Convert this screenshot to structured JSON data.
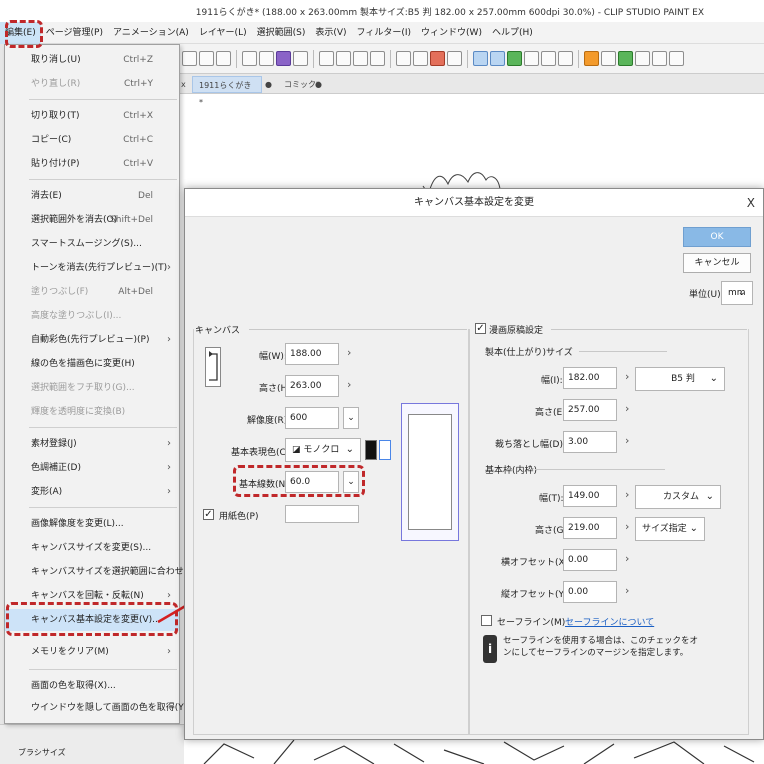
{
  "window": {
    "title": "1911らくがき* (188.00 x 263.00mm 製本サイズ:B5 判 182.00 x 257.00mm 600dpi 30.0%) - CLIP STUDIO PAINT EX"
  },
  "menubar": {
    "items": [
      "編集(E)",
      "ページ管理(P)",
      "アニメーション(A)",
      "レイヤー(L)",
      "選択範囲(S)",
      "表示(V)",
      "フィルター(I)",
      "ウィンドウ(W)",
      "ヘルプ(H)"
    ]
  },
  "doc_tabs": [
    {
      "label": "1911らくがき*",
      "close": "x",
      "dot": "●"
    },
    {
      "label": "コミック*",
      "dot": "●"
    }
  ],
  "edit_menu": {
    "items": [
      {
        "label": "取り消し(U)",
        "shortcut": "Ctrl+Z"
      },
      {
        "label": "やり直し(R)",
        "shortcut": "Ctrl+Y",
        "disabled": true
      },
      {
        "label": "切り取り(T)",
        "shortcut": "Ctrl+X"
      },
      {
        "label": "コピー(C)",
        "shortcut": "Ctrl+C"
      },
      {
        "label": "貼り付け(P)",
        "shortcut": "Ctrl+V"
      },
      {
        "label": "消去(E)",
        "shortcut": "Del"
      },
      {
        "label": "選択範囲外を消去(O)",
        "shortcut": "Shift+Del"
      },
      {
        "label": "スマートスムージング(S)..."
      },
      {
        "label": "トーンを消去(先行プレビュー)(T)",
        "submenu": true
      },
      {
        "label": "塗りつぶし(F)",
        "shortcut": "Alt+Del",
        "disabled": true
      },
      {
        "label": "高度な塗りつぶし(I)...",
        "disabled": true
      },
      {
        "label": "自動彩色(先行プレビュー)(P)",
        "submenu": true
      },
      {
        "label": "線の色を描画色に変更(H)"
      },
      {
        "label": "選択範囲をフチ取り(G)...",
        "disabled": true
      },
      {
        "label": "輝度を透明度に変換(B)",
        "disabled": true
      },
      {
        "label": "素材登録(J)",
        "submenu": true
      },
      {
        "label": "色調補正(D)",
        "submenu": true
      },
      {
        "label": "変形(A)",
        "submenu": true
      },
      {
        "label": "画像解像度を変更(L)..."
      },
      {
        "label": "キャンバスサイズを変更(S)..."
      },
      {
        "label": "キャンバスサイズを選択範囲に合わせる(Z)"
      },
      {
        "label": "キャンバスを回転・反転(N)",
        "submenu": true
      },
      {
        "label": "キャンバス基本設定を変更(V)..."
      },
      {
        "label": "メモリをクリア(M)",
        "submenu": true
      },
      {
        "label": "画面の色を取得(X)..."
      },
      {
        "label": "ウインドウを隠して画面の色を取得(Y)..."
      }
    ]
  },
  "dialog": {
    "title": "キャンバス基本設定を変更",
    "close": "X",
    "ok": "OK",
    "cancel": "キャンセル",
    "unit_label": "単位(U):",
    "unit_value": "mm",
    "canvas_section": "キャンバス",
    "width_label": "幅(W):",
    "width_value": "188.00",
    "height_label": "高さ(H):",
    "height_value": "263.00",
    "resolution_label": "解像度(R):",
    "resolution_value": "600",
    "color_label": "基本表現色(C):",
    "color_value": "モノクロ",
    "lpi_label": "基本線数(N):",
    "lpi_value": "60.0",
    "paper_label": "用紙色(P)",
    "manga_label": "漫画原稿設定",
    "bind_section": "製本(仕上がり)サイズ",
    "bind_width_label": "幅(I):",
    "bind_width_value": "182.00",
    "bind_preset": "B5 判",
    "bind_height_label": "高さ(E):",
    "bind_height_value": "257.00",
    "bleed_label": "裁ち落とし幅(D):",
    "bleed_value": "3.00",
    "frame_section": "基本枠(内枠)",
    "frame_width_label": "幅(T):",
    "frame_width_value": "149.00",
    "frame_preset": "カスタム",
    "frame_height_label": "高さ(G):",
    "frame_height_value": "219.00",
    "frame_size_spec": "サイズ指定",
    "xoffset_label": "横オフセット(X):",
    "xoffset_value": "0.00",
    "yoffset_label": "縦オフセット(Y):",
    "yoffset_value": "0.00",
    "safeline_label": "セーフライン(M)",
    "safeline_link": "セーフラインについて",
    "safeline_note": "セーフラインを使用する場合は、このチェックをオンにしてセーフラインのマージンを指定します。"
  },
  "bottom_panel": {
    "label": "ブラシサイズ"
  },
  "colors": {
    "highlight_red": "#c0282a",
    "ok_blue": "#89b9e6",
    "link_blue": "#1a5fc4"
  }
}
